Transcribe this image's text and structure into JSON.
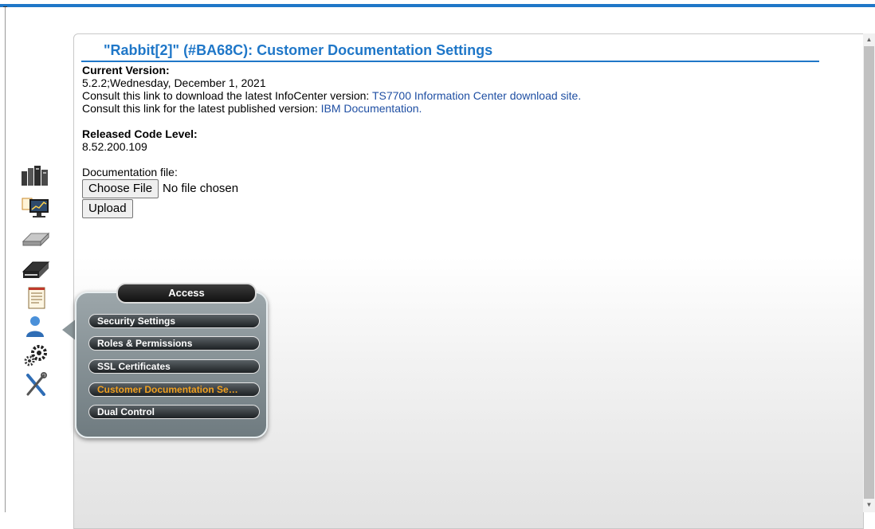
{
  "header": {
    "title": "\"Rabbit[2]\" (#BA68C): Customer Documentation Settings",
    "accent_color": "#1f77c8"
  },
  "content": {
    "current_version_label": "Current Version:",
    "current_version_value": "5.2.2;Wednesday, December 1, 2021",
    "infocenter_line": "Consult this link to download the latest InfoCenter version: ",
    "infocenter_link": "TS7700 Information Center download site.",
    "published_line": "Consult this link for the latest published version: ",
    "published_link": "IBM Documentation.",
    "released_label": "Released Code Level:",
    "released_value": "8.52.200.109",
    "doc_file_label": "Documentation file:",
    "choose_file_button": "Choose File",
    "no_file_text": "No file chosen",
    "upload_button": "Upload"
  },
  "nav": {
    "icons": [
      "systems-icon",
      "monitor-icon",
      "virtual-drive-icon",
      "physical-drive-icon",
      "notepad-icon",
      "user-access-icon",
      "gears-icon",
      "tools-icon"
    ]
  },
  "popup": {
    "title": "Access",
    "items": [
      {
        "label": "Security Settings"
      },
      {
        "label": "Roles & Permissions"
      },
      {
        "label": "SSL Certificates"
      },
      {
        "label": "Customer Documentation Se…",
        "active": true
      },
      {
        "label": "Dual Control"
      }
    ],
    "active_color": "#f0a020"
  }
}
